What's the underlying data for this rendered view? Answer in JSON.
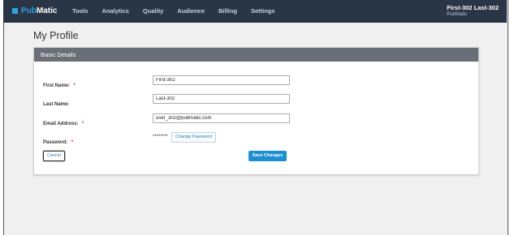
{
  "brand": {
    "name_part1": "Pub",
    "name_part2": "Matic",
    "accent": "#2aa4e0"
  },
  "nav": {
    "items": [
      {
        "label": "Tools"
      },
      {
        "label": "Analytics"
      },
      {
        "label": "Quality"
      },
      {
        "label": "Audience"
      },
      {
        "label": "Billing"
      },
      {
        "label": "Settings"
      }
    ]
  },
  "user": {
    "name": "First-302 Last-302",
    "org": "PubMatic"
  },
  "page": {
    "title": "My Profile"
  },
  "card": {
    "header": "Basic Details",
    "first_name": {
      "label": "First Name:",
      "required": "*",
      "value": "First-302"
    },
    "last_name": {
      "label": "Last Name:",
      "value": "Last-302"
    },
    "email": {
      "label": "Email Address:",
      "required": "*",
      "value": "user_302@pubmatic.com"
    },
    "password": {
      "label": "Password:",
      "required": "*",
      "masked": "********",
      "change_label": "Change Password"
    },
    "cancel_label": "Cancel",
    "save_label": "Save Changes"
  },
  "colors": {
    "topbar": "#2a3546",
    "card_header": "#6a6f77",
    "save_button": "#1d8fcf"
  }
}
